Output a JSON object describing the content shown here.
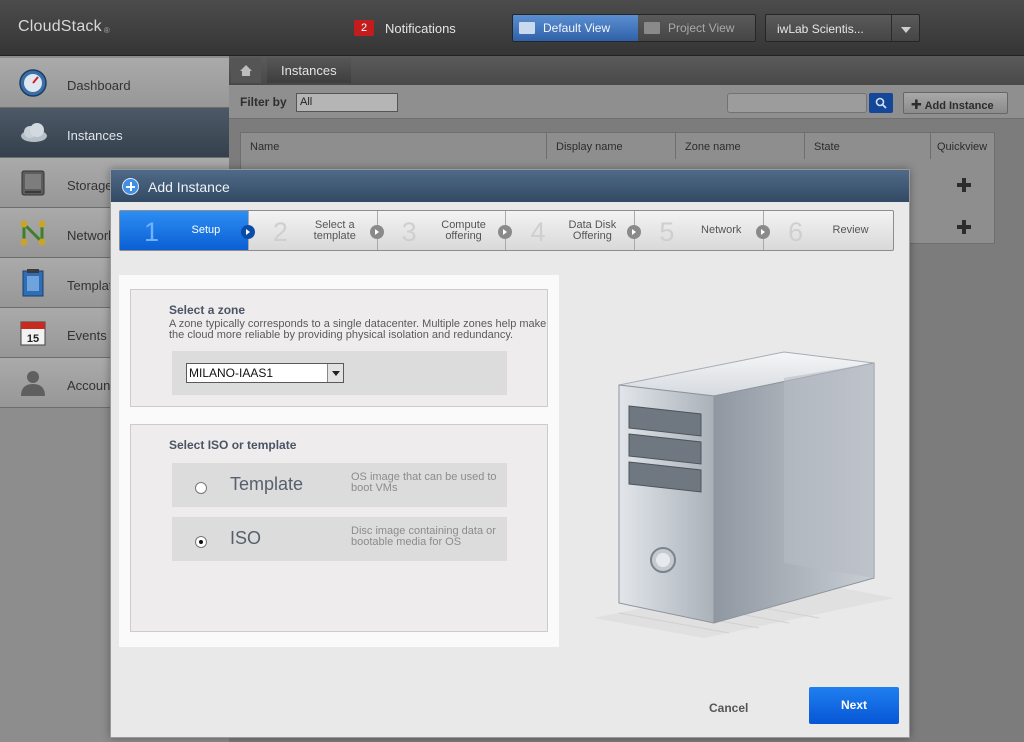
{
  "header": {
    "logo": "CloudStack",
    "logo_mark": "®",
    "notifications_count": "2",
    "notifications_label": "Notifications",
    "default_view": "Default View",
    "project_view": "Project View",
    "project_selected": "iwLab Scientis..."
  },
  "sidebar": {
    "items": [
      {
        "label": "Dashboard",
        "icon": "dashboard-gauge-icon",
        "active": false
      },
      {
        "label": "Instances",
        "icon": "cloud-icon",
        "active": true
      },
      {
        "label": "Storage",
        "icon": "storage-disk-icon",
        "active": false
      },
      {
        "label": "Network",
        "icon": "network-icon",
        "active": false
      },
      {
        "label": "Templates",
        "icon": "template-icon",
        "active": false
      },
      {
        "label": "Events",
        "icon": "calendar-icon",
        "active": false
      },
      {
        "label": "Accounts",
        "icon": "user-icon",
        "active": false
      }
    ],
    "events_day": "15"
  },
  "main": {
    "breadcrumb": "Instances",
    "filter_label": "Filter by",
    "filter_value": "All",
    "add_instance": "Add Instance",
    "columns": [
      "Name",
      "Display name",
      "Zone name",
      "State",
      "Quickview"
    ]
  },
  "modal": {
    "title": "Add Instance",
    "steps": [
      {
        "num": "1",
        "label": "Setup",
        "active": true
      },
      {
        "num": "2",
        "label": "Select a template",
        "active": false
      },
      {
        "num": "3",
        "label": "Compute offering",
        "active": false
      },
      {
        "num": "4",
        "label": "Data Disk Offering",
        "active": false
      },
      {
        "num": "5",
        "label": "Network",
        "active": false
      },
      {
        "num": "6",
        "label": "Review",
        "active": false
      }
    ],
    "zone": {
      "title": "Select a zone",
      "description": "A zone typically corresponds to a single datacenter. Multiple zones help make the cloud more reliable by providing physical isolation and redundancy.",
      "selected": "MILANO-IAAS1"
    },
    "source": {
      "title": "Select ISO or template",
      "options": [
        {
          "label": "Template",
          "description": "OS image that can be used to boot VMs",
          "checked": false
        },
        {
          "label": "ISO",
          "description": "Disc image containing data or bootable media for OS",
          "checked": true
        }
      ]
    },
    "cancel": "Cancel",
    "next": "Next"
  }
}
